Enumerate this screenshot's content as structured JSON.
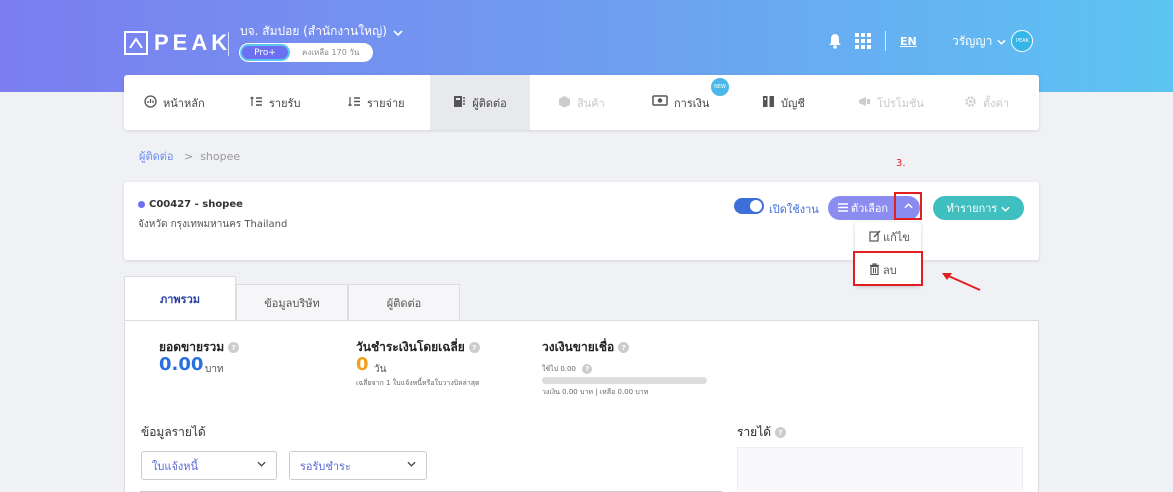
{
  "header": {
    "logo_text": "PEAK",
    "company": "บจ. สัมปอย (สำนักงานใหญ่)",
    "plan": "Pro+",
    "days_left": "คงเหลือ 170 วัน",
    "lang": "EN",
    "user": "วรัญญา",
    "avatar_text": "PEAK",
    "colors": {
      "gradient_start": "#7b7ef0",
      "gradient_end": "#5cc4f2"
    }
  },
  "nav": {
    "items": [
      {
        "label": "หน้าหลัก",
        "icon": "dashboard-icon"
      },
      {
        "label": "รายรับ",
        "icon": "income-icon"
      },
      {
        "label": "รายจ่าย",
        "icon": "expense-icon"
      },
      {
        "label": "ผู้ติดต่อ",
        "icon": "contacts-icon"
      },
      {
        "label": "สินค้า",
        "icon": "product-icon"
      },
      {
        "label": "การเงิน",
        "icon": "money-icon"
      },
      {
        "label": "บัญชี",
        "icon": "book-icon"
      },
      {
        "label": "โปรโมชั่น",
        "icon": "promo-icon"
      },
      {
        "label": "ตั้งค่า",
        "icon": "gear-icon"
      }
    ],
    "new_badge": "NEW"
  },
  "breadcrumb": {
    "parent": "ผู้ติดต่อ",
    "sep": ">",
    "current": "shopee"
  },
  "annotation": {
    "step": "3."
  },
  "contact": {
    "code_name": "C00427 - shopee",
    "address": "จังหวัด กรุงเทพมหานคร Thailand",
    "toggle_label": "เปิดใช้งาน",
    "options_label": "ตัวเลือก",
    "action_label": "ทำรายการ",
    "menu": {
      "edit": "แก้ไข",
      "delete": "ลบ"
    }
  },
  "tabs": [
    "ภาพรวม",
    "ข้อมูลบริษัท",
    "ผู้ติดต่อ"
  ],
  "overview": {
    "total_sales_label": "ยอดขายรวม",
    "total_sales_value": "0.00",
    "total_sales_unit": "บาท",
    "avg_days_label": "วันชำระเงินโดยเฉลี่ย",
    "avg_days_value": "0",
    "avg_days_unit": "วัน",
    "avg_days_note": "เฉลี่ยจาก 1 ใบแจ้งหนี้หรือใบวางบิลล่าสุด",
    "credit_label": "วงเงินขายเชื่อ",
    "credit_used": "ใช้ไป 0.00",
    "credit_note": "วงเงิน 0.00 บาท | เหลือ 0.00 บาท",
    "credit_used_fraction": 0,
    "income_section": "ข้อมูลรายได้",
    "select_doc": "ใบแจ้งหนี้",
    "select_status": "รอรับชำระ",
    "revenue_label": "รายได้"
  }
}
